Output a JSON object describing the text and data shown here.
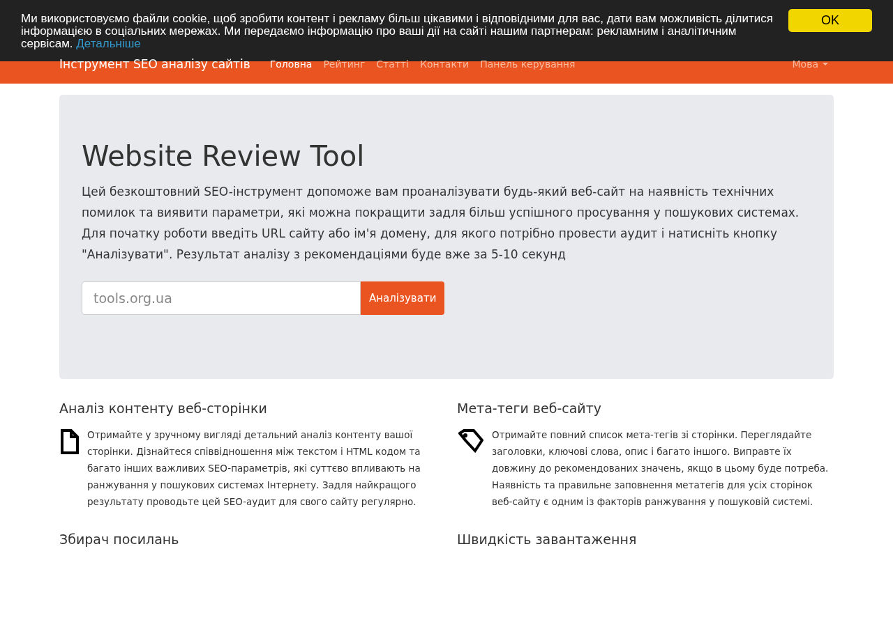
{
  "cookie_banner": {
    "text": "Ми використовуємо файли cookie, щоб зробити контент і рекламу більш цікавими і відповідними для вас, дати вам можливість ділитися інформацією в соціальних мережах. Ми передаємо інформацію про ваші дії на сайті нашим партнерам: рекламним і аналітичним сервісам.",
    "link": "Детальніше",
    "button": "OK"
  },
  "navbar": {
    "brand": "Інструмент SEO аналізу сайтів",
    "items": [
      {
        "label": "Головна",
        "selected": true
      },
      {
        "label": "Рейтинг",
        "selected": false
      },
      {
        "label": "Статті",
        "selected": false
      },
      {
        "label": "Контакти",
        "selected": false
      },
      {
        "label": "Панель керування",
        "selected": false
      }
    ],
    "language_menu": "Мова"
  },
  "hero": {
    "title": "Website Review Tool",
    "description": "Цей безкоштовний SEO-інструмент допоможе вам проаналізувати будь-який веб-сайт на наявність технічних помилок та виявити параметри, які можна покращити задля більш успішного просування у пошукових системах. Для початку роботи введіть URL сайту або ім'я домену, для якого потрібно провести аудит і натисніть кнопку \"Аналізувати\". Результат аналізу з рекомендаціями буде вже за 5-10 секунд",
    "placeholder": "tools.org.ua",
    "button": "Аналізувати"
  },
  "features": [
    {
      "kind": "document",
      "title": "Аналіз контенту веб-сторінки",
      "text": "Отримайте у зручному вигляді детальний аналіз контенту вашої сторінки. Дізнайтеся співвідношення між текстом і HTML кодом та багато інших важливих SEO-параметрів, які суттєво впливають на ранжування у пошукових системах Інтернету. Задля найкращого результату проводьте цей SEO-аудит для свого сайту регулярно."
    },
    {
      "kind": "tag",
      "title": "Мета-теги веб-сайту",
      "text": "Отримайте повний список мета-тегів зі сторінки. Переглядайте заголовки, ключові слова, опис і багато іншого. Виправте їх довжину до рекомендованих значень, якщо в цьому буде потреба. Наявність та правильне заповнення метатегів для усіх сторінок веб-сайту є одним із факторів ранжування у пошуковій системі."
    },
    {
      "title": "Збирач посилань"
    },
    {
      "title": "Швидкість завантаження"
    }
  ]
}
